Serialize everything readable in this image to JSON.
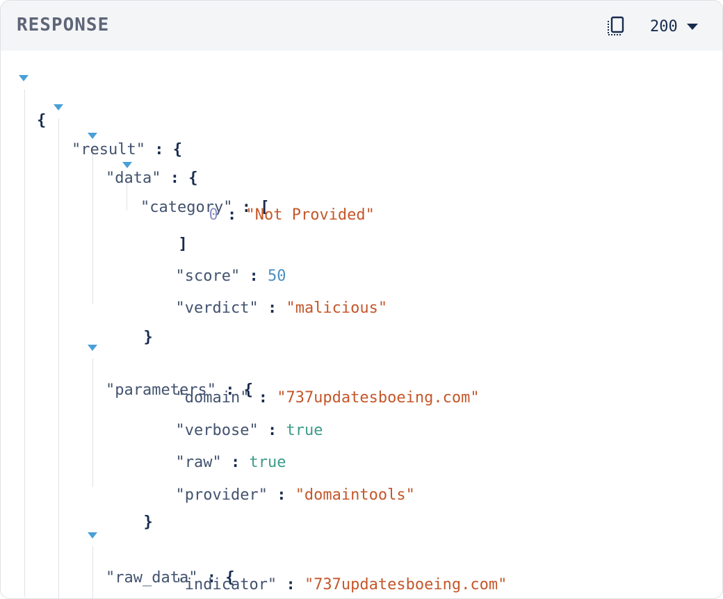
{
  "header": {
    "title": "RESPONSE",
    "status_code": "200"
  },
  "icons": {
    "copy": "copy-icon",
    "dropdown": "caret-down-icon",
    "toggle": "triangle-down-icon"
  },
  "json": {
    "open_brace": "{",
    "close_brace": "}",
    "open_bracket": "[",
    "close_bracket": "]",
    "colon": ":",
    "result_key": "\"result\"",
    "data_key": "\"data\"",
    "category_key": "\"category\"",
    "category_items": [
      {
        "index": "0",
        "value": "\"Not Provided\""
      }
    ],
    "score_key": "\"score\"",
    "score_value": "50",
    "verdict_key": "\"verdict\"",
    "verdict_value": "\"malicious\"",
    "parameters_key": "\"parameters\"",
    "domain_key": "\"domain\"",
    "domain_value": "\"737updatesboeing.com\"",
    "verbose_key": "\"verbose\"",
    "verbose_value": "true",
    "raw_key": "\"raw\"",
    "raw_value": "true",
    "provider_key": "\"provider\"",
    "provider_value": "\"domaintools\"",
    "raw_data_key": "\"raw_data\"",
    "indicator_key": "\"indicator\"",
    "indicator_value": "\"737updatesboeing.com\""
  },
  "colors": {
    "string": "#c4572a",
    "number": "#4a8fc0",
    "boolean": "#3b9b8a",
    "key": "#42526e",
    "toggle": "#4a9fd8",
    "header_bg": "#f4f5f7"
  }
}
